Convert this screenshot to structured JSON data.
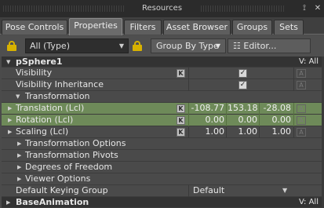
{
  "window": {
    "title": "Resources",
    "pin_glyph": "⟟",
    "close_glyph": "✕"
  },
  "tabs": [
    {
      "label": "Pose Controls",
      "active": false
    },
    {
      "label": "Properties",
      "active": true
    },
    {
      "label": "Filters",
      "active": false
    },
    {
      "label": "Asset Browser",
      "active": false
    },
    {
      "label": "Groups",
      "active": false
    },
    {
      "label": "Sets",
      "active": false
    }
  ],
  "toolbar": {
    "filter_value": "All (Type)",
    "group_by_label": "Group By Type",
    "editor_label": "Editor...",
    "editor_icon": "☷"
  },
  "rows": {
    "psphere": {
      "label": "pSphere1",
      "mode": "V: All"
    },
    "visibility": {
      "label": "Visibility",
      "k": "K",
      "check": "✓",
      "a": "A"
    },
    "visibility_inheritance": {
      "label": "Visibility Inheritance",
      "check": "✓",
      "a": "A"
    },
    "transformation": {
      "label": "Transformation"
    },
    "translation": {
      "label": "Translation (Lcl)",
      "k": "K",
      "x": "-108.77",
      "y": "153.18",
      "z": "-28.08",
      "a": "A"
    },
    "rotation": {
      "label": "Rotation (Lcl)",
      "k": "K",
      "x": "0.00",
      "y": "0.00",
      "z": "0.00",
      "a": "A"
    },
    "scaling": {
      "label": "Scaling (Lcl)",
      "k": "K",
      "x": "1.00",
      "y": "1.00",
      "z": "1.00",
      "a": "A"
    },
    "transformation_options": {
      "label": "Transformation Options"
    },
    "transformation_pivots": {
      "label": "Transformation Pivots"
    },
    "degrees_of_freedom": {
      "label": "Degrees of Freedom"
    },
    "viewer_options": {
      "label": "Viewer Options"
    },
    "default_keying_group": {
      "label": "Default Keying Group",
      "value": "Default"
    },
    "base_animation": {
      "label": "BaseAnimation",
      "mode": "V: All"
    }
  },
  "colors": {
    "panel_bg": "#4a4a4a",
    "header_bg": "#333333",
    "animated_green": "#6e8a59",
    "lock_yellow": "#d8b200"
  }
}
